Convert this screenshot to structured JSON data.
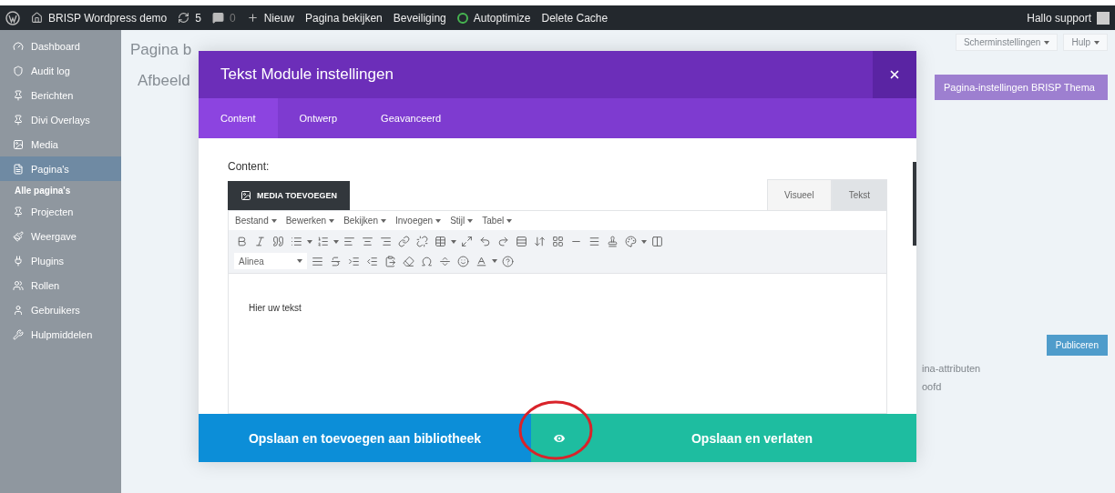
{
  "admin_bar": {
    "items": [
      {
        "kind": "logo"
      },
      {
        "kind": "site",
        "label": "BRISP Wordpress demo"
      },
      {
        "kind": "updates",
        "label": "5"
      },
      {
        "kind": "comments",
        "label": "0"
      },
      {
        "kind": "new",
        "label": "Nieuw"
      },
      {
        "kind": "link",
        "label": "Pagina bekijken"
      },
      {
        "kind": "link",
        "label": "Beveiliging"
      },
      {
        "kind": "status",
        "label": "Autoptimize"
      },
      {
        "kind": "link",
        "label": "Delete Cache"
      }
    ],
    "account": "Hallo support"
  },
  "sidebar": {
    "items": [
      {
        "label": "Dashboard",
        "kind": "gauge",
        "selected": false
      },
      {
        "label": "Audit log",
        "kind": "shield",
        "selected": false
      },
      {
        "label": "Berichten",
        "kind": "pin",
        "selected": false
      },
      {
        "label": "Divi Overlays",
        "kind": "pin",
        "selected": false
      },
      {
        "label": "Media",
        "kind": "media",
        "selected": false
      },
      {
        "label": "Pagina's",
        "kind": "page",
        "selected": true,
        "children": [
          {
            "label": "Alle pagina's",
            "selected": true
          }
        ]
      },
      {
        "label": "Projecten",
        "kind": "pin",
        "selected": false
      },
      {
        "label": "Weergave",
        "kind": "brush",
        "selected": false
      },
      {
        "label": "Plugins",
        "kind": "plug",
        "selected": false
      },
      {
        "label": "Rollen",
        "kind": "users",
        "selected": false
      },
      {
        "label": "Gebruikers",
        "kind": "user",
        "selected": false
      },
      {
        "label": "Hulpmiddelen",
        "kind": "wrench",
        "selected": false
      }
    ]
  },
  "page": {
    "title": "Pagina b",
    "subtitle": "Afbeeld"
  },
  "right_panel": {
    "screen_options": "Scherminstellingen",
    "help": "Hulp",
    "box_title": "Pagina-instellingen BRISP Thema",
    "publish": "Publiceren",
    "attributes": "ina-attributen",
    "parent": "oofd"
  },
  "modal": {
    "title": "Tekst Module instellingen",
    "tabs": [
      {
        "label": "Content",
        "selected": true
      },
      {
        "label": "Ontwerp",
        "selected": false
      },
      {
        "label": "Geavanceerd",
        "selected": false
      }
    ],
    "content_label": "Content:",
    "media_button": "MEDIA TOEVOEGEN",
    "editor_tabs": [
      {
        "label": "Visueel",
        "selected": true
      },
      {
        "label": "Tekst",
        "selected": false
      }
    ],
    "menu": [
      "Bestand",
      "Bewerken",
      "Bekijken",
      "Invoegen",
      "Stijl",
      "Tabel"
    ],
    "format_select": "Alinea",
    "body_text": "Hier uw tekst",
    "footer": {
      "save_library": "Opslaan en toevoegen aan bibliotheek",
      "save_exit": "Opslaan en verlaten"
    }
  }
}
